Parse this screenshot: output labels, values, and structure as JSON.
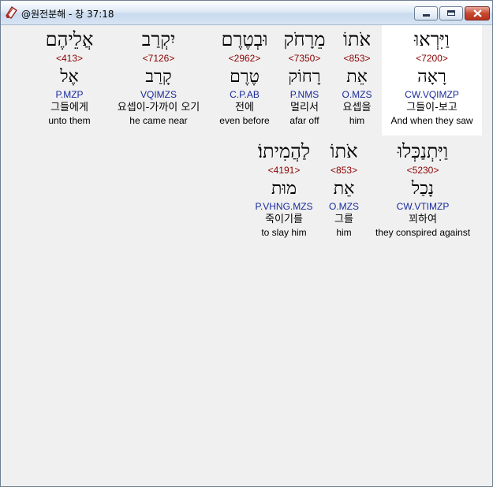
{
  "window": {
    "title": "@원전분해 - 창 37:18"
  },
  "rows": [
    {
      "words": [
        {
          "hebrew": "וַיִּרְאוּ",
          "strong": "<7200>",
          "lemma": "רָאָה",
          "morph": "CW.VQIMZP",
          "korean": "그들이-보고",
          "english": "And when they saw"
        },
        {
          "hebrew": "אֹתוֹ",
          "strong": "<853>",
          "lemma": "אֵת",
          "morph": "O.MZS",
          "korean": "요셉을",
          "english": "him"
        },
        {
          "hebrew": "מֵרָחֹק",
          "strong": "<7350>",
          "lemma": "רָחוֹק",
          "morph": "P.NMS",
          "korean": "멀리서",
          "english": "afar off"
        },
        {
          "hebrew": "וּבְטֶרֶם",
          "strong": "<2962>",
          "lemma": "טֶרֶם",
          "morph": "C.P.AB",
          "korean": "전에",
          "english": "even before"
        },
        {
          "hebrew": "יִקְרַב",
          "strong": "<7126>",
          "lemma": "קָרַב",
          "morph": "VQIMZS",
          "korean": "요셉이-가까이 오기",
          "english": "he came near"
        },
        {
          "hebrew": "אֲלֵיהֶם",
          "strong": "<413>",
          "lemma": "אֶל",
          "morph": "P.MZP",
          "korean": "그들에게",
          "english": "unto them"
        }
      ]
    },
    {
      "words": [
        {
          "hebrew": "וַיִּתְנַכְּלוּ",
          "strong": "<5230>",
          "lemma": "נָכַל",
          "morph": "CW.VTIMZP",
          "korean": "꾀하여",
          "english": "they conspired against"
        },
        {
          "hebrew": "אֹתוֹ",
          "strong": "<853>",
          "lemma": "אֵת",
          "morph": "O.MZS",
          "korean": "그를",
          "english": "him"
        },
        {
          "hebrew": "לַהֲמִיתוֹ׃",
          "strong": "<4191>",
          "lemma": "מוּת",
          "morph": "P.VHNG.MZS",
          "korean": "죽이기를",
          "english": "to slay him"
        }
      ]
    }
  ]
}
